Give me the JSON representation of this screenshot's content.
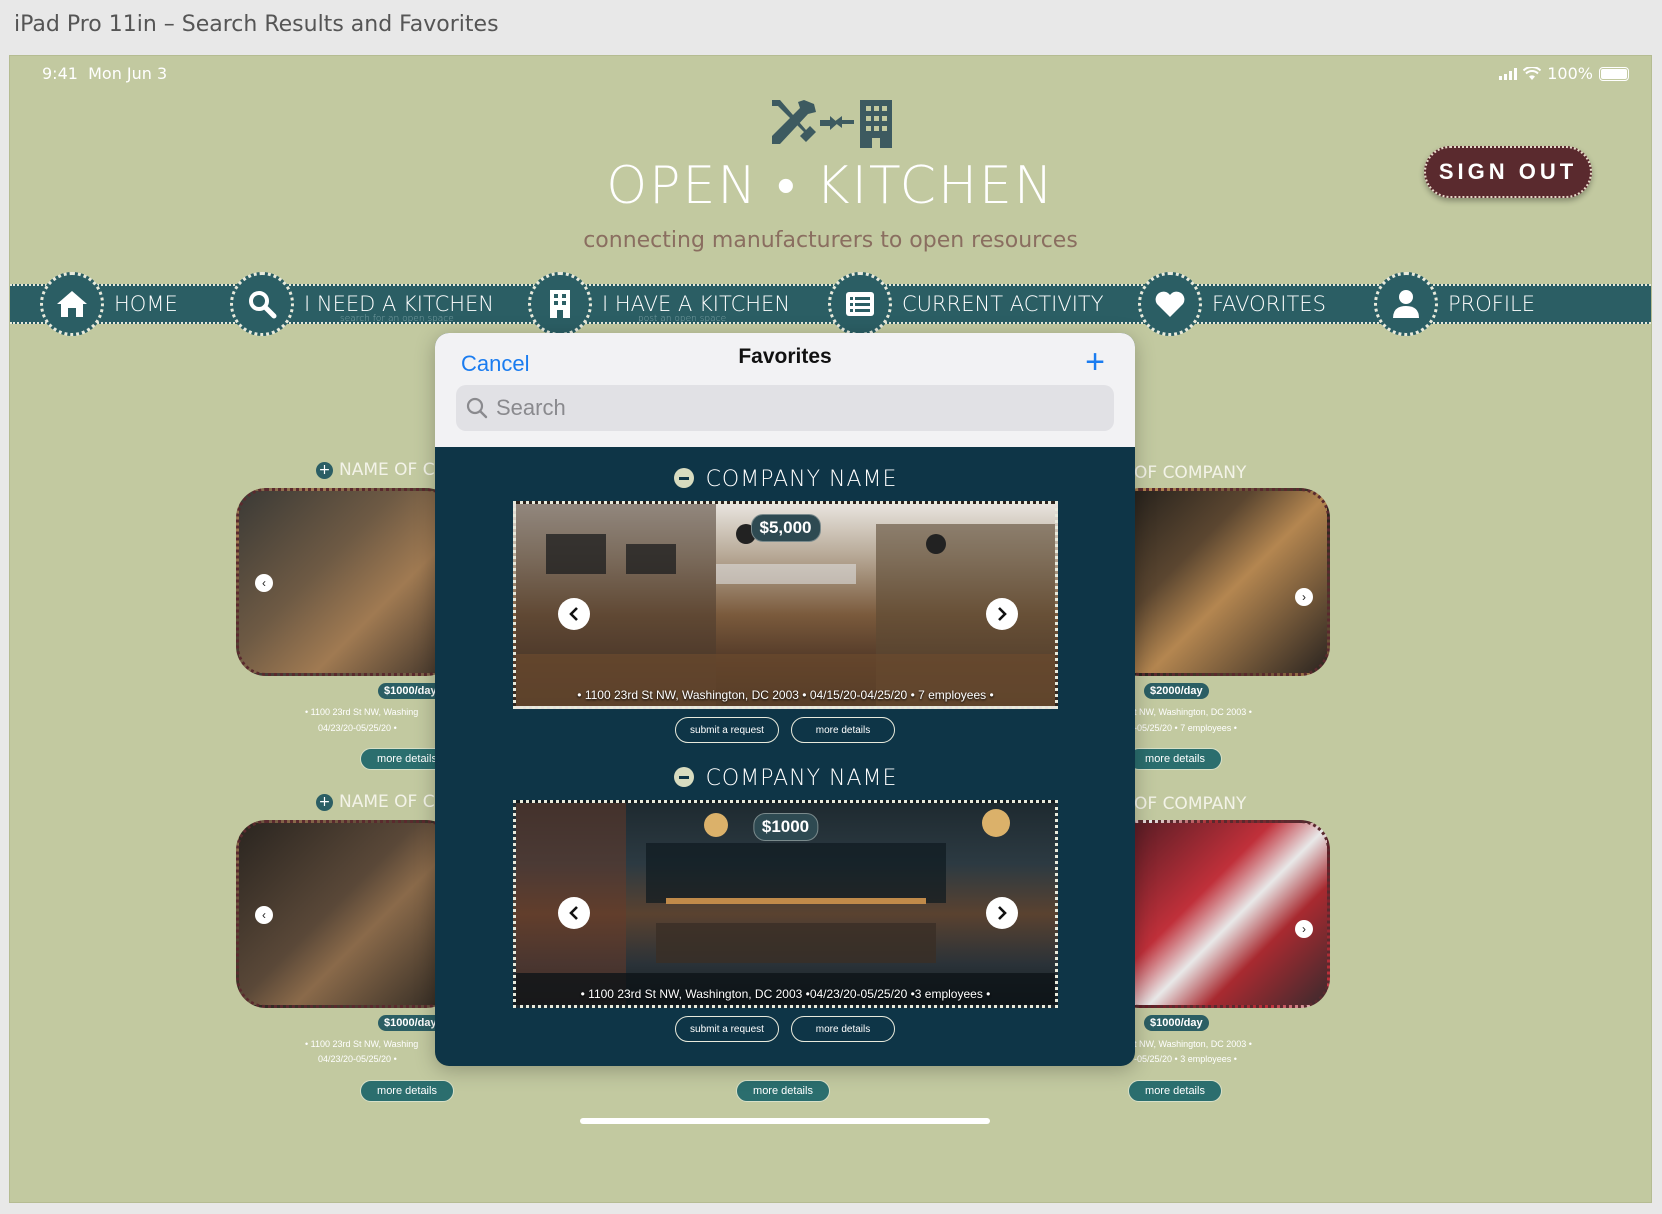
{
  "frame_title": "iPad Pro 11in – Search Results and Favorites",
  "status": {
    "time": "9:41",
    "date": "Mon Jun 3",
    "battery": "100%"
  },
  "brand": {
    "name": "OPEN • KITCHEN",
    "tagline": "connecting manufacturers to open resources"
  },
  "signout_label": "SIGN OUT",
  "nav": {
    "home": "HOME",
    "need": "I NEED A KITCHEN",
    "need_sub": "search for an open space",
    "have": "I HAVE A KITCHEN",
    "have_sub": "post an open space",
    "activity": "CURRENT ACTIVITY",
    "favorites": "FAVORITES",
    "profile": "PROFILE"
  },
  "background": {
    "left_top": {
      "name": "NAME OF CO",
      "price": "$1000/day",
      "addr": "• 1100 23rd St NW, Washing",
      "dates": "04/23/20-05/25/20 •",
      "more": "more details"
    },
    "left_bottom": {
      "name": "NAME OF CO",
      "price": "$1000/day",
      "addr": "• 1100 23rd St NW, Washing",
      "dates": "04/23/20-05/25/20 •",
      "more": "more details"
    },
    "right_top": {
      "name": "OF COMPANY",
      "price": "$2000/day",
      "addr": "t NW, Washington, DC 2003 •",
      "dates": "-05/25/20 •",
      "people": "7 employees •",
      "more": "more details"
    },
    "right_bottom": {
      "name": "OF COMPANY",
      "price": "$1000/day",
      "addr": "t NW, Washington, DC 2003 •",
      "dates": "-05/25/20 •",
      "people": "3 employees •",
      "more": "more details"
    },
    "center_bottom_more": "more details"
  },
  "modal": {
    "cancel": "Cancel",
    "title": "Favorites",
    "search_placeholder": "Search",
    "items": [
      {
        "name": "COMPANY NAME",
        "price": "$5,000",
        "info": "• 1100 23rd St NW, Washington, DC 2003 • 04/15/20-04/25/20 • 7 employees •",
        "request": "submit a request",
        "details": "more details"
      },
      {
        "name": "COMPANY NAME",
        "price": "$1000",
        "info": "• 1100 23rd St NW, Washington, DC 2003 •04/23/20-05/25/20 •3 employees •",
        "request": "submit a request",
        "details": "more details"
      }
    ]
  },
  "colors": {
    "background": "#c2c9a0",
    "nav": "#2b5e64",
    "modal": "#0e3547",
    "signout": "#5a2a2e",
    "accent": "#1a7cf0"
  }
}
